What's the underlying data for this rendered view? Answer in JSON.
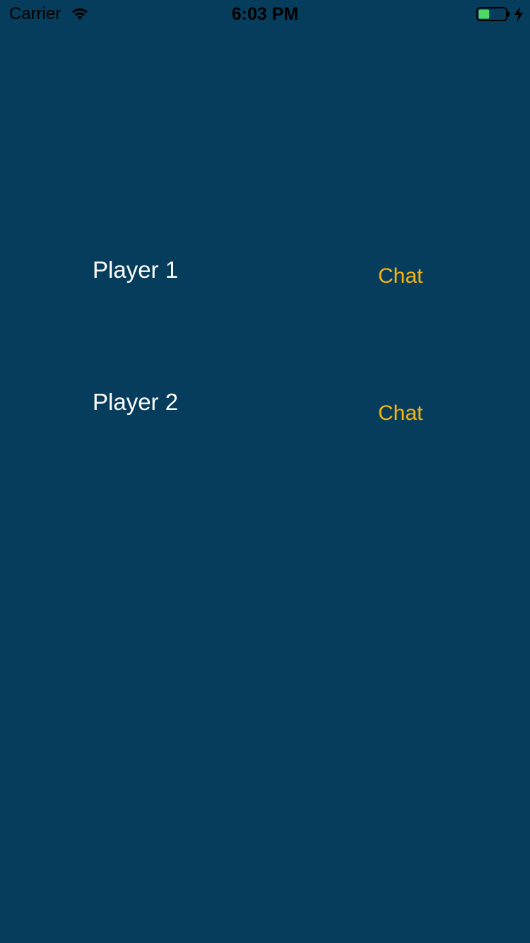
{
  "status_bar": {
    "carrier": "Carrier",
    "time": "6:03 PM",
    "battery_level": 0.4,
    "charging": true,
    "icons": [
      "wifi-icon",
      "battery-icon",
      "charging-bolt-icon"
    ]
  },
  "players": [
    {
      "name": "Player 1",
      "chat_label": "Chat"
    },
    {
      "name": "Player 2",
      "chat_label": "Chat"
    }
  ],
  "colors": {
    "background": "#073d5c",
    "player_text": "#ffffff",
    "chat_accent": "#f5b312",
    "battery_fill": "#4cd964"
  }
}
